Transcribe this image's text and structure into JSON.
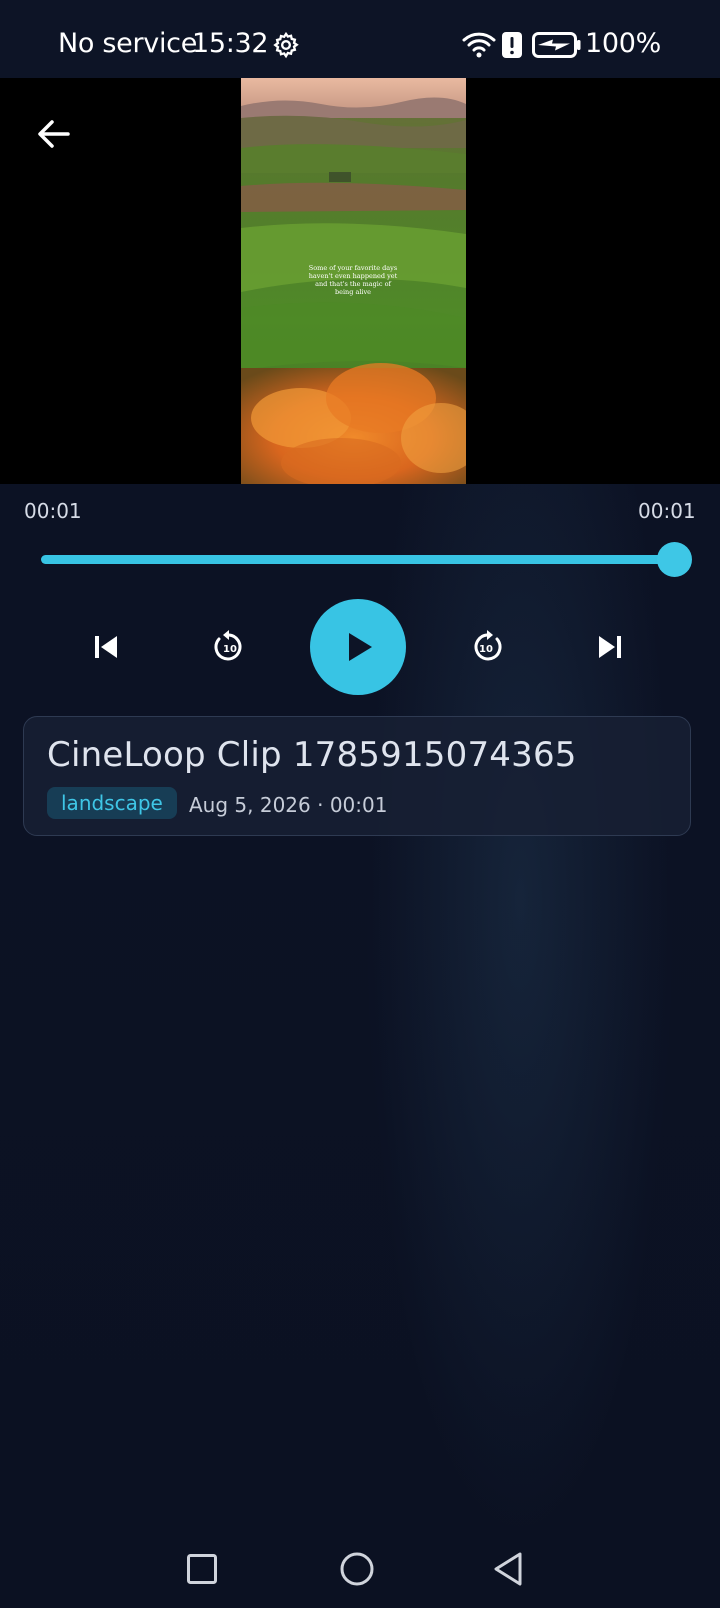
{
  "status_bar": {
    "carrier": "No service",
    "time": "15:32",
    "battery": "100%",
    "icons": [
      "gear-icon",
      "wifi-icon",
      "alert-icon",
      "battery-charging-icon"
    ]
  },
  "video": {
    "overlay_caption": [
      "Some of your favorite days",
      "haven't even happened yet",
      "and that's the magic of",
      "being alive"
    ]
  },
  "player": {
    "current_time": "00:01",
    "total_time": "00:01",
    "progress": 1.0,
    "accent_color": "#38c4e4"
  },
  "clip": {
    "title": "CineLoop Clip 1785915074365",
    "tag": "landscape",
    "meta": "Aug 5, 2026 · 00:01"
  }
}
